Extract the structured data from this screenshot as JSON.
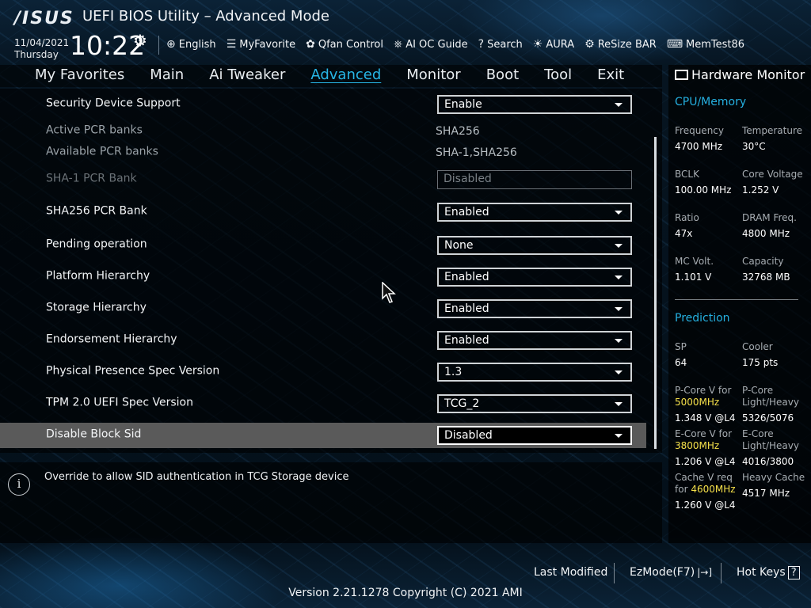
{
  "header": {
    "logo": "/ISUS",
    "title": "UEFI BIOS Utility – Advanced Mode",
    "date": "11/04/2021",
    "day": "Thursday",
    "time": "10:22"
  },
  "toolbar": [
    {
      "icon": "globe-icon",
      "glyph": "⊕",
      "label": "English"
    },
    {
      "icon": "favorite-icon",
      "glyph": "☰",
      "label": "MyFavorite"
    },
    {
      "icon": "fan-icon",
      "glyph": "✿",
      "label": "Qfan Control"
    },
    {
      "icon": "ai-oc-icon",
      "glyph": "⎈",
      "label": "AI OC Guide"
    },
    {
      "icon": "help-icon",
      "glyph": "?",
      "label": "Search"
    },
    {
      "icon": "aura-icon",
      "glyph": "☀",
      "label": "AURA"
    },
    {
      "icon": "resize-bar-icon",
      "glyph": "⚙",
      "label": "ReSize BAR"
    },
    {
      "icon": "memtest-icon",
      "glyph": "⌨",
      "label": "MemTest86"
    }
  ],
  "tabs": [
    "My Favorites",
    "Main",
    "Ai Tweaker",
    "Advanced",
    "Monitor",
    "Boot",
    "Tool",
    "Exit"
  ],
  "active_tab": "Advanced",
  "settings": [
    {
      "label": "Security Device Support",
      "type": "dropdown",
      "value": "Enable"
    },
    {
      "label": "Active PCR banks",
      "type": "text",
      "value": "SHA256"
    },
    {
      "label": "Available PCR banks",
      "type": "text",
      "value": "SHA-1,SHA256"
    },
    {
      "label": "SHA-1 PCR Bank",
      "type": "disabled",
      "value": "Disabled"
    },
    {
      "label": "SHA256 PCR Bank",
      "type": "dropdown",
      "value": "Enabled"
    },
    {
      "label": "Pending operation",
      "type": "dropdown",
      "value": "None"
    },
    {
      "label": "Platform Hierarchy",
      "type": "dropdown",
      "value": "Enabled"
    },
    {
      "label": "Storage Hierarchy",
      "type": "dropdown",
      "value": "Enabled"
    },
    {
      "label": "Endorsement Hierarchy",
      "type": "dropdown",
      "value": "Enabled"
    },
    {
      "label": "Physical Presence Spec Version",
      "type": "dropdown",
      "value": "1.3"
    },
    {
      "label": "TPM 2.0 UEFI Spec Version",
      "type": "dropdown",
      "value": "TCG_2"
    },
    {
      "label": "Disable Block Sid",
      "type": "dropdown",
      "value": "Disabled",
      "selected": true
    }
  ],
  "help_text": "Override to allow SID authentication in TCG Storage device",
  "hardware_monitor": {
    "title": "Hardware Monitor",
    "cpu_memory": {
      "title": "CPU/Memory",
      "frequency_label": "Frequency",
      "frequency": "4700 MHz",
      "temperature_label": "Temperature",
      "temperature": "30°C",
      "bclk_label": "BCLK",
      "bclk": "100.00 MHz",
      "core_voltage_label": "Core Voltage",
      "core_voltage": "1.252 V",
      "ratio_label": "Ratio",
      "ratio": "47x",
      "dram_freq_label": "DRAM Freq.",
      "dram_freq": "4800 MHz",
      "mc_volt_label": "MC Volt.",
      "mc_volt": "1.101 V",
      "capacity_label": "Capacity",
      "capacity": "32768 MB"
    },
    "prediction": {
      "title": "Prediction",
      "sp_label": "SP",
      "sp": "64",
      "cooler_label": "Cooler",
      "cooler": "175 pts",
      "pcore_v_label": "P-Core V for",
      "pcore_v_freq": "5000MHz",
      "pcore_v": "1.348 V @L4",
      "pcore_lh_label1": "P-Core",
      "pcore_lh_label2": "Light/Heavy",
      "pcore_lh": "5326/5076",
      "ecore_v_label": "E-Core V for",
      "ecore_v_freq": "3800MHz",
      "ecore_v": "1.206 V @L4",
      "ecore_lh_label1": "E-Core",
      "ecore_lh_label2": "Light/Heavy",
      "ecore_lh": "4016/3800",
      "cache_v_label1": "Cache V req",
      "cache_v_label2": "for",
      "cache_v_freq": "4600MHz",
      "cache_v": "1.260 V @L4",
      "heavy_cache_label": "Heavy Cache",
      "heavy_cache": "4517 MHz"
    }
  },
  "footer": {
    "last_modified": "Last Modified",
    "ezmode": "EzMode(F7)",
    "hot_keys": "Hot Keys",
    "hot_keys_key": "?",
    "version": "Version 2.21.1278 Copyright (C) 2021 AMI"
  },
  "colors": {
    "accent": "#27b6e6",
    "highlight": "#f5e04a",
    "selected_row": "#5a5a5a"
  }
}
